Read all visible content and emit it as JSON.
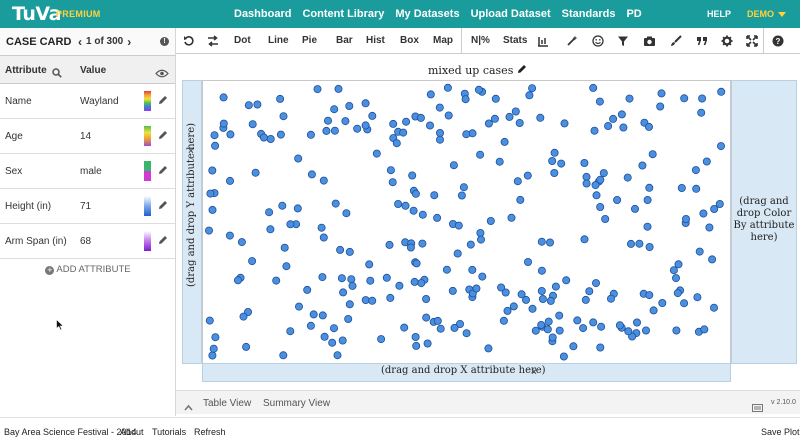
{
  "nav": {
    "logo": "TuVa",
    "logo_sub": "PREMIUM",
    "links": [
      "Dashboard",
      "Content Library",
      "My Datasets",
      "Upload Dataset",
      "Standards",
      "PD"
    ],
    "help": "HELP",
    "user": "DEMO",
    "bg_color": "#1a9c9c",
    "accent_color": "#ffd23c"
  },
  "case_card": {
    "title": "CASE CARD",
    "counter": "1 of 300",
    "col_attribute": "Attribute",
    "col_value": "Value",
    "rows": [
      {
        "name": "Name",
        "value": "Wayland"
      },
      {
        "name": "Age",
        "value": "14"
      },
      {
        "name": "Sex",
        "value": "male"
      },
      {
        "name": "Height (in)",
        "value": "71"
      },
      {
        "name": "Arm Span (in)",
        "value": "68"
      }
    ],
    "add_attribute": "ADD ATTRIBUTE"
  },
  "toolbar": {
    "plot_types": [
      "Dot",
      "Line",
      "Pie",
      "Bar",
      "Hist",
      "Box",
      "Map"
    ],
    "percent_label": "N|%",
    "stats_label": "Stats"
  },
  "graph": {
    "title": "mixed up cases",
    "y_drop": "(drag and drop Y attribute here)",
    "x_drop": "(drag and drop X attribute here)",
    "color_drop": "(drag and drop Color By attribute here)",
    "point_color": "#4a8fe0",
    "point_count": 300
  },
  "bottom": {
    "table_view": "Table View",
    "summary_view": "Summary View",
    "version": "v 2.10.0"
  },
  "footer": {
    "dataset": "Bay Area Science Festival - 2014",
    "about": "About",
    "tutorials": "Tutorials",
    "refresh": "Refresh",
    "save_plot": "Save Plot"
  }
}
